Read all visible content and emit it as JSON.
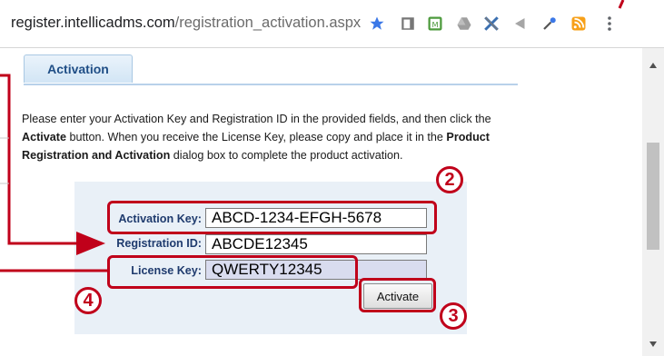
{
  "address_bar": {
    "url_host": "register.intellicadms.com",
    "url_path": "/registration_activation.aspx"
  },
  "toolbar_icons": [
    "bookmark-star-icon",
    "extension-document-icon",
    "extension-m-icon",
    "extension-drive-icon",
    "extension-x-icon",
    "extension-arrow-icon",
    "eyedropper-icon",
    "rss-icon",
    "menu-dots-icon"
  ],
  "tab": {
    "label": "Activation"
  },
  "intro": {
    "part1": "Please enter your Activation Key and Registration ID in the provided fields, and then click the ",
    "activate_word": "Activate",
    "part2": " button. When you receive the License Key, please copy and place it in the ",
    "dialog_name": "Product Registration and Activation",
    "part3": " dialog box to complete the product activation."
  },
  "form": {
    "activation_key_label": "Activation Key:",
    "activation_key_value": "ABCD-1234-EFGH-5678",
    "registration_id_label": "Registration ID:",
    "registration_id_value": "ABCDE12345",
    "license_key_label": "License Key:",
    "license_key_value": "QWERTY12345",
    "activate_button": "Activate"
  },
  "annotations": {
    "step2": "2",
    "step3": "3",
    "step4": "4",
    "color": "#c0001a"
  }
}
